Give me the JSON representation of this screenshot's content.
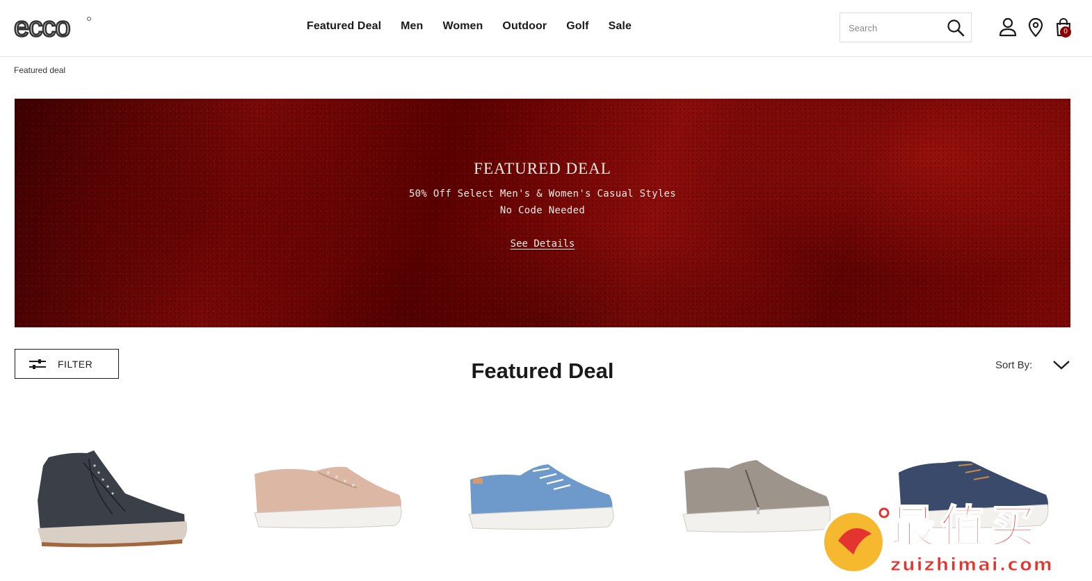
{
  "header": {
    "logo_text": "ecco",
    "nav": [
      "Featured Deal",
      "Men",
      "Women",
      "Outdoor",
      "Golf",
      "Sale"
    ],
    "search_placeholder": "Search",
    "cart_count": "0"
  },
  "breadcrumb": "Featured deal",
  "banner": {
    "title": "FEATURED DEAL",
    "subtitle": "50% Off Select Men's & Women's Casual Styles",
    "subtitle2": "No Code Needed",
    "link": "See Details"
  },
  "toolbar": {
    "filter_label": "FILTER",
    "page_title": "Featured Deal",
    "sort_label": "Sort By:"
  },
  "products": [
    {
      "name": "dark grey high-top sneaker",
      "color": "#3b3f47"
    },
    {
      "name": "rose blush perforated sneaker",
      "color": "#dcb7a4"
    },
    {
      "name": "light blue lace-up sneaker",
      "color": "#6e9acb"
    },
    {
      "name": "taupe zip sneaker",
      "color": "#9d948b"
    },
    {
      "name": "navy lace-up sneaker",
      "color": "#3a4a6b"
    }
  ],
  "watermark": {
    "text": "最值买",
    "url": "zuizhimai.com"
  }
}
